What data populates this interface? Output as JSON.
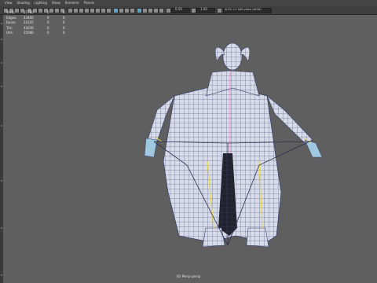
{
  "menubar": [
    "View",
    "Shading",
    "Lighting",
    "Show",
    "Renderer",
    "Panels"
  ],
  "toolbar": {
    "fields": [
      "0.00",
      "1.00"
    ],
    "colorspace": "ACES 1.0 SDR-video (sRGB)"
  },
  "hud": {
    "stats": [
      {
        "label": "Verts:",
        "c1": "21780",
        "c2": "0",
        "c3": "0"
      },
      {
        "label": "Edges:",
        "c1": "43400",
        "c2": "0",
        "c3": "0"
      },
      {
        "label": "Faces:",
        "c1": "21625",
        "c2": "0",
        "c3": "0"
      },
      {
        "label": "Tris:",
        "c1": "43036",
        "c2": "0",
        "c3": "0"
      },
      {
        "label": "UVs:",
        "c1": "25080",
        "c2": "0",
        "c3": "0"
      }
    ],
    "camera_label": "(6) Persp  persp"
  },
  "colors": {
    "viewport": "#5f5f5f",
    "mesh": "#d7dbe8",
    "wire": "#3a3f6a",
    "accent": "#5aa7c7"
  }
}
